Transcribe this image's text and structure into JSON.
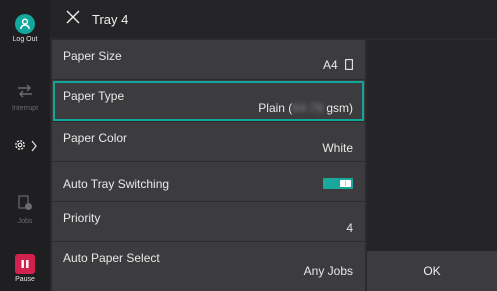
{
  "header": {
    "title": "Tray 4"
  },
  "rail": {
    "logout": "Log Out",
    "interrupt": "Interrupt",
    "jobs": "Jobs",
    "pause": "Pause"
  },
  "settings": [
    {
      "label": "Paper Size",
      "value": "A4"
    },
    {
      "label": "Paper Type",
      "value_prefix": "Plain (",
      "value_obscured": "64-79",
      "value_suffix": " gsm)"
    },
    {
      "label": "Paper Color",
      "value": "White"
    },
    {
      "label": "Auto Tray Switching",
      "toggle_on": true
    },
    {
      "label": "Priority",
      "value": "4"
    },
    {
      "label": "Auto Paper Select",
      "value": "Any Jobs"
    }
  ],
  "ok_label": "OK",
  "colors": {
    "accent": "#13a89e",
    "pause": "#d2214f"
  },
  "icons": [
    "close-icon",
    "user-logout-icon",
    "interrupt-icon",
    "gear-icon",
    "chevron-right-icon",
    "jobs-icon",
    "pause-icon",
    "portrait-paper-icon"
  ]
}
